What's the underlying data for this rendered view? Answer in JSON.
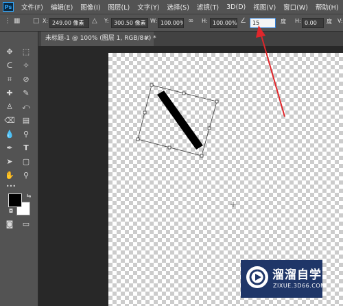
{
  "menubar": {
    "logo": "Ps",
    "items": [
      "文件(F)",
      "编辑(E)",
      "图像(I)",
      "图层(L)",
      "文字(Y)",
      "选择(S)",
      "滤镜(T)",
      "3D(D)",
      "视图(V)",
      "窗口(W)",
      "帮助(H)"
    ]
  },
  "options": {
    "x_label": "X:",
    "x_value": "249.00 像素",
    "y_label": "Y:",
    "y_value": "300.50 像素",
    "w_label": "W:",
    "w_value": "100.00%",
    "h_label": "H:",
    "h_value": "100.00%",
    "angle_value": "15",
    "angle_unit": "度",
    "hskew_label": "H:",
    "hskew_value": "0.00",
    "hskew_unit": "度",
    "v_label": "V:"
  },
  "document": {
    "tab_title": "未标题-1 @ 100% (图层 1, RGB/8#) *",
    "close": "×"
  },
  "toolbar": {
    "more": "•••"
  },
  "watermark": {
    "title": "溜溜自学",
    "url": "ZIXUE.3D66.COM"
  },
  "colors": {
    "annotation_arrow": "#e0262b",
    "ui_panel": "#535353",
    "workspace": "#282828",
    "watermark_bg": "#1f3668"
  }
}
